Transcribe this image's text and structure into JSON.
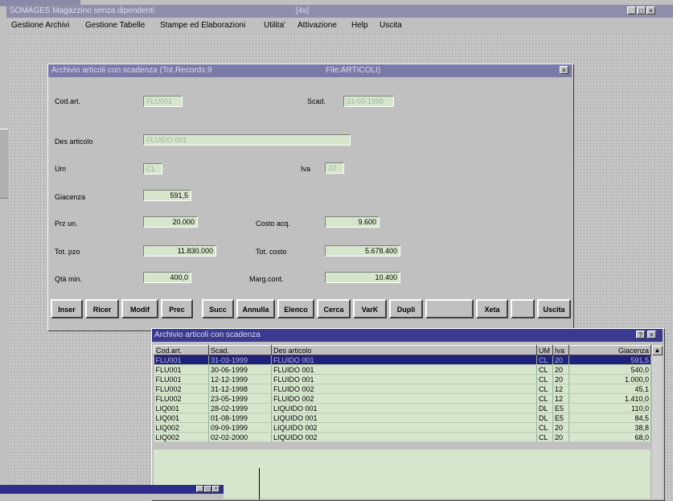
{
  "app": {
    "title": "SOMAGES Magazzino senza dipendenti",
    "title_center": "[4s]",
    "mini_title": "SOMAGES"
  },
  "menu": [
    {
      "label": "Gestione Archivi"
    },
    {
      "label": "Gestione Tabelle"
    },
    {
      "label": "Stampe ed Elaborazioni"
    },
    {
      "label": "Utilita'"
    },
    {
      "label": "Attivazione"
    },
    {
      "label": "Help"
    },
    {
      "label": "Uscita"
    }
  ],
  "form": {
    "title": "Archivio articoli con scadenza (Tot.Records:9",
    "title_right": "File:ARTICOLI)",
    "labels": {
      "cod_art": "Cod.art.",
      "scad": "Scad.",
      "des_articolo": "Des articolo",
      "um": "Um",
      "iva": "Iva",
      "giacenza": "Giacenza",
      "prz_un": "Prz un.",
      "costo_acq": "Costo acq.",
      "tot_pzo": "Tot. pzo",
      "tot_costo": "Tot. costo",
      "qta_min": "Qtà min.",
      "marg_cont": "Marg.cont."
    },
    "values": {
      "cod_art": "FLU001",
      "scad": "31-03-1999",
      "des_articolo": "FLUIDO 001",
      "um": "CL",
      "iva": "20",
      "giacenza": "591,5",
      "prz_un": "20.000",
      "costo_acq": "9.600",
      "tot_pzo": "11.830.000",
      "tot_costo": "5.678.400",
      "qta_min": "400,0",
      "marg_cont": "10.400"
    },
    "buttons": [
      {
        "label": "Inser"
      },
      {
        "label": "Ricer"
      },
      {
        "label": "Modif"
      },
      {
        "label": "Prec"
      },
      {
        "label": "Succ"
      },
      {
        "label": "Annulla"
      },
      {
        "label": "Elenco"
      },
      {
        "label": "Cerca"
      },
      {
        "label": "VarK"
      },
      {
        "label": "Dupli"
      },
      {
        "label": ""
      },
      {
        "label": "Xeta"
      },
      {
        "label": ""
      },
      {
        "label": "Uscita"
      }
    ]
  },
  "grid": {
    "title": "Archivio articoli con scadenza",
    "headers": [
      "Cod.art.",
      "Scad.",
      "Des articolo",
      "UM",
      "Iva",
      "Giacenza"
    ],
    "rows": [
      [
        "FLU001",
        "31-03-1999",
        "FLUIDO 001",
        "CL",
        "20",
        "591,5"
      ],
      [
        "FLU001",
        "30-06-1999",
        "FLUIDO 001",
        "CL",
        "20",
        "540,0"
      ],
      [
        "FLU001",
        "12-12-1999",
        "FLUIDO 001",
        "CL",
        "20",
        "1.000,0"
      ],
      [
        "FLU002",
        "31-12-1998",
        "FLUIDO 002",
        "CL",
        "12",
        "45,1"
      ],
      [
        "FLU002",
        "23-05-1999",
        "FLUIDO 002",
        "CL",
        "12",
        "1.410,0"
      ],
      [
        "LIQ001",
        "28-02-1999",
        "LIQUIDO 001",
        "DL",
        "E5",
        "110,0"
      ],
      [
        "LIQ001",
        "01-08-1999",
        "LIQUIDO 001",
        "DL",
        "E5",
        "84,5"
      ],
      [
        "LIQ002",
        "09-09-1999",
        "LIQUIDO 002",
        "CL",
        "20",
        "38,8"
      ],
      [
        "LIQ002",
        "02-02-2000",
        "LIQUIDO 002",
        "CL",
        "20",
        "68,0"
      ]
    ],
    "selected_row": 0
  },
  "colors": {
    "titlebar": "#7a7aa6",
    "grid_titlebar": "#3b3b8e",
    "selection": "#22227a",
    "field_bg": "#d6e6cc"
  }
}
